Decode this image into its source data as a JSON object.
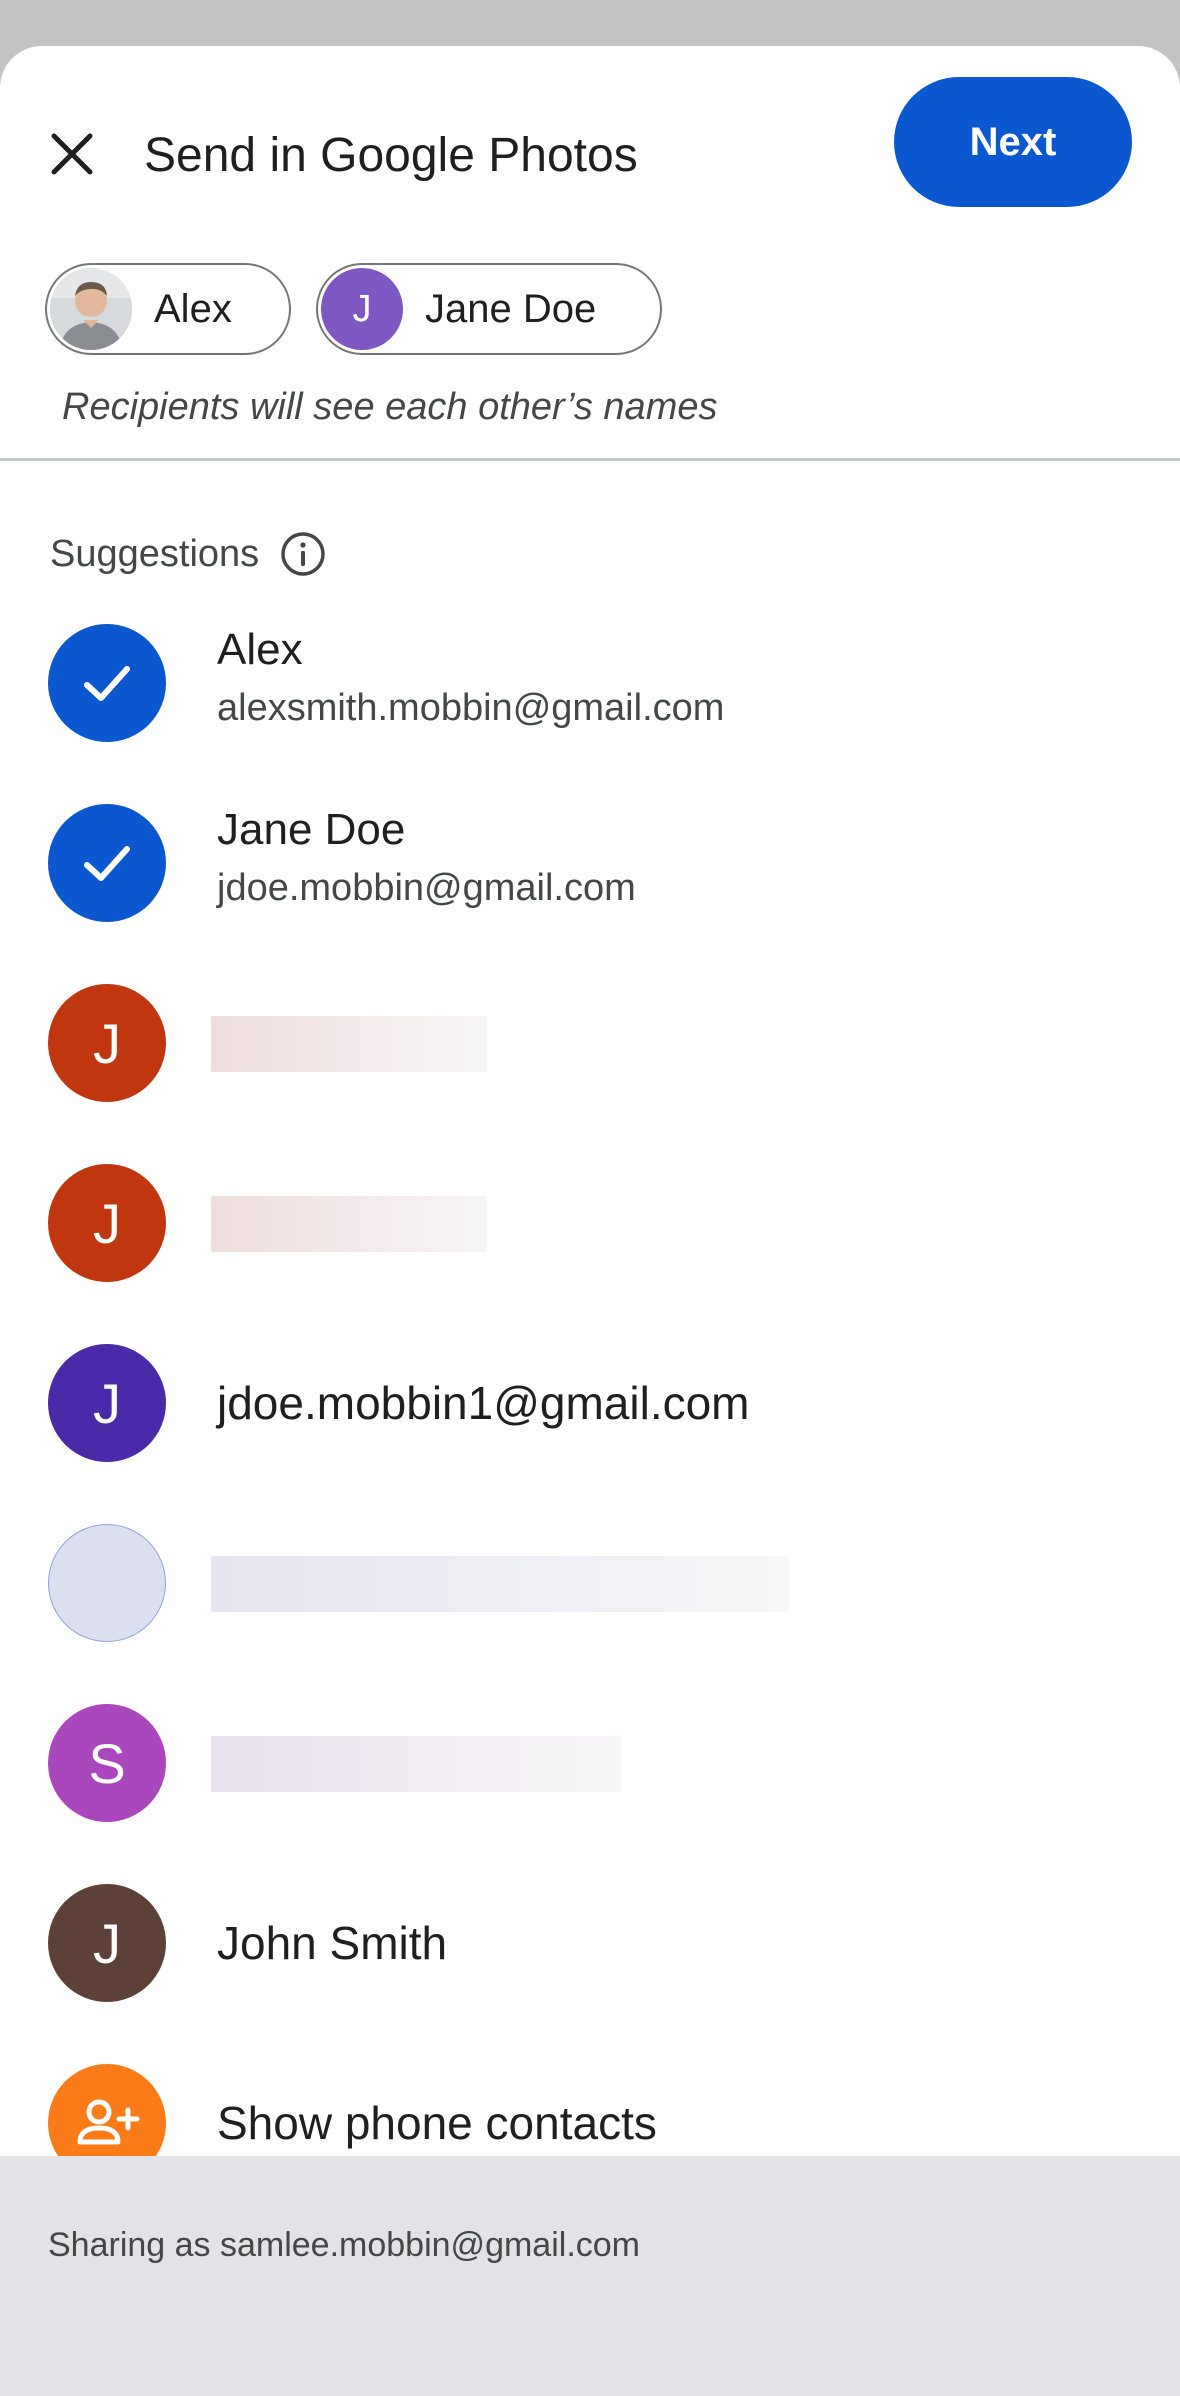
{
  "header": {
    "title": "Send in Google Photos",
    "next_label": "Next"
  },
  "recipients": {
    "chips": [
      {
        "label": "Alex",
        "avatar": "photo"
      },
      {
        "label": "Jane Doe",
        "initial": "J"
      }
    ],
    "note": "Recipients will see each other’s names"
  },
  "suggestions": {
    "label": "Suggestions",
    "items": [
      {
        "name": "Alex",
        "email": "alexsmith.mobbin@gmail.com",
        "selected": true,
        "color": "#0b57d0"
      },
      {
        "name": "Jane Doe",
        "email": "jdoe.mobbin@gmail.com",
        "selected": true,
        "color": "#0b57d0"
      },
      {
        "initial": "J",
        "color": "#c0360f",
        "loading": true
      },
      {
        "initial": "J",
        "color": "#c0360f",
        "loading": true
      },
      {
        "initial": "J",
        "color": "#4a2aa8",
        "text": "jdoe.mobbin1@gmail.com"
      },
      {
        "initial": "",
        "color": "#dcdff0",
        "loading": true
      },
      {
        "initial": "S",
        "color": "#ab47bc",
        "loading": true
      },
      {
        "initial": "J",
        "color": "#5d4037",
        "text": "John Smith"
      },
      {
        "icon": "add-person-icon",
        "color": "#fa7b17",
        "text": "Show phone contacts"
      }
    ]
  },
  "footer": {
    "sharing_as": "Sharing as samlee.mobbin@gmail.com"
  }
}
